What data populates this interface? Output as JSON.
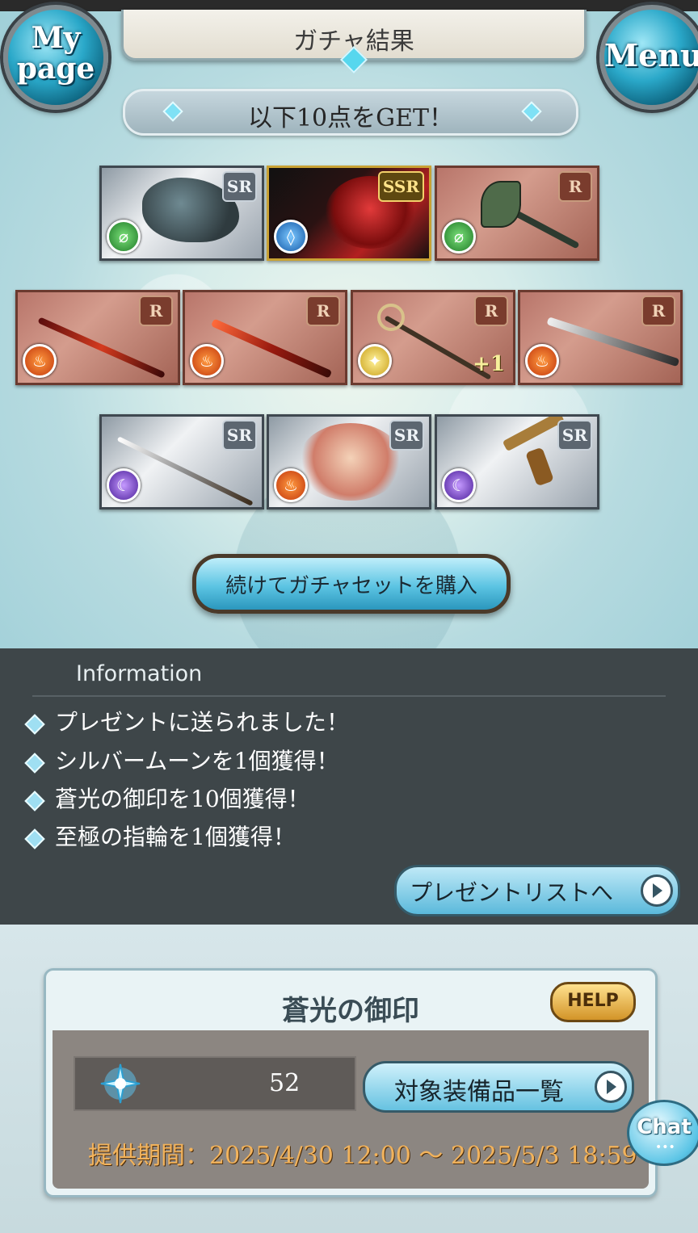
{
  "header": {
    "title": "ガチャ結果",
    "mypage_label_1": "My",
    "mypage_label_2": "page",
    "menu_label": "Menu"
  },
  "banner": {
    "text": "以下10点をGET！"
  },
  "cards": [
    {
      "rarity": "SR",
      "element": "wind",
      "kind": "summon-dragon"
    },
    {
      "rarity": "SSR",
      "element": "water",
      "kind": "character"
    },
    {
      "rarity": "R",
      "element": "wind",
      "kind": "axe"
    },
    {
      "rarity": "R",
      "element": "fire",
      "kind": "spear"
    },
    {
      "rarity": "R",
      "element": "fire",
      "kind": "dagger"
    },
    {
      "rarity": "R",
      "element": "light",
      "kind": "staff",
      "plus": "+1"
    },
    {
      "rarity": "R",
      "element": "fire",
      "kind": "sword"
    },
    {
      "rarity": "SR",
      "element": "dark",
      "kind": "katana"
    },
    {
      "rarity": "SR",
      "element": "fire",
      "kind": "summon-beast"
    },
    {
      "rarity": "SR",
      "element": "dark",
      "kind": "gun"
    }
  ],
  "buy_button": {
    "label": "続けてガチャセットを購入"
  },
  "info": {
    "title": "Information",
    "items": [
      "プレゼントに送られました！",
      "シルバームーンを1個獲得！",
      "蒼光の御印を10個獲得！",
      "至極の指輪を1個獲得！"
    ],
    "present_button": "プレゼントリストへ"
  },
  "seal_panel": {
    "title": "蒼光の御印",
    "help_label": "HELP",
    "count": "52",
    "equip_button": "対象装備品一覧",
    "period": "提供期間：2025/4/30 12:00 ～ 2025/5/3 18:59"
  },
  "chat": {
    "label": "Chat",
    "dots": "•••"
  }
}
